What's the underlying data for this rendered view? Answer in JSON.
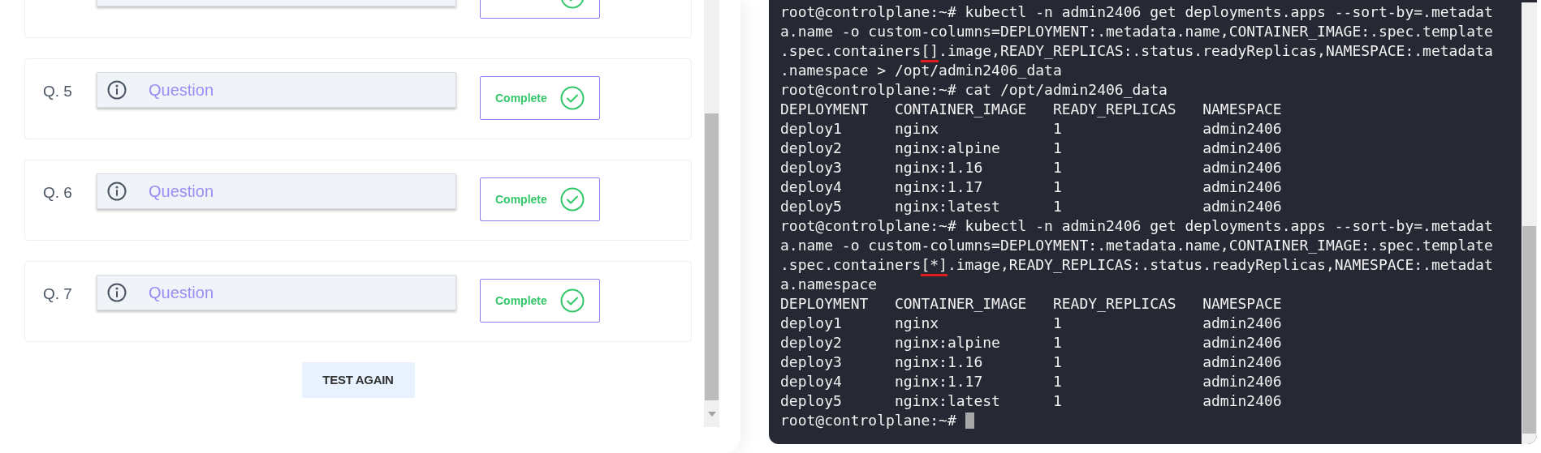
{
  "questions": [
    {
      "completed": true
    },
    {
      "number": "Q. 5",
      "placeholder": "Question",
      "status": "Complete",
      "completed": true
    },
    {
      "number": "Q. 6",
      "placeholder": "Question",
      "status": "Complete",
      "completed": true
    },
    {
      "number": "Q. 7",
      "placeholder": "Question",
      "status": "Complete",
      "completed": true
    }
  ],
  "test_again_button": "TEST AGAIN",
  "terminal": {
    "lines": [
      {
        "text": "root@controlplane:~# kubectl -n admin2406 get deployments.apps --sort-by=.metadat"
      },
      {
        "text": "a.name -o custom-columns=DEPLOYMENT:.metadata.name,CONTAINER_IMAGE:.spec.template"
      },
      {
        "kind": "marked",
        "before": ".spec.containers",
        "mark": "[]",
        "after": ".image,READY_REPLICAS:.status.readyReplicas,NAMESPACE:.metadata"
      },
      {
        "text": ".namespace > /opt/admin2406_data"
      },
      {
        "text": "root@controlplane:~# cat /opt/admin2406_data"
      },
      {
        "text": "DEPLOYMENT   CONTAINER_IMAGE   READY_REPLICAS   NAMESPACE"
      },
      {
        "text": "deploy1      nginx             1                admin2406"
      },
      {
        "text": "deploy2      nginx:alpine      1                admin2406"
      },
      {
        "text": "deploy3      nginx:1.16        1                admin2406"
      },
      {
        "text": "deploy4      nginx:1.17        1                admin2406"
      },
      {
        "text": "deploy5      nginx:latest      1                admin2406"
      },
      {
        "text": "root@controlplane:~# kubectl -n admin2406 get deployments.apps --sort-by=.metadat"
      },
      {
        "text": "a.name -o custom-columns=DEPLOYMENT:.metadata.name,CONTAINER_IMAGE:.spec.template"
      },
      {
        "kind": "marked",
        "before": ".spec.containers",
        "mark": "[*]",
        "after": ".image,READY_REPLICAS:.status.readyReplicas,NAMESPACE:.metadat"
      },
      {
        "text": "a.namespace"
      },
      {
        "text": "DEPLOYMENT   CONTAINER_IMAGE   READY_REPLICAS   NAMESPACE"
      },
      {
        "text": "deploy1      nginx             1                admin2406"
      },
      {
        "text": "deploy2      nginx:alpine      1                admin2406"
      },
      {
        "text": "deploy3      nginx:1.16        1                admin2406"
      },
      {
        "text": "deploy4      nginx:1.17        1                admin2406"
      },
      {
        "text": "deploy5      nginx:latest      1                admin2406"
      },
      {
        "kind": "prompt",
        "text": "root@controlplane:~#",
        "cursor": true
      }
    ]
  }
}
